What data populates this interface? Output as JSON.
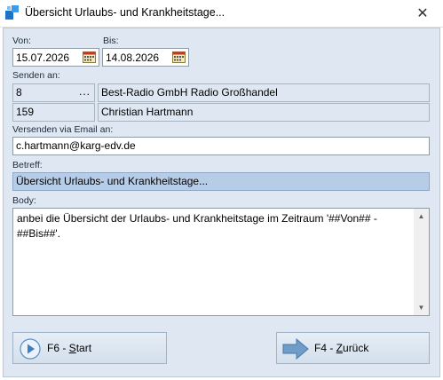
{
  "window": {
    "title": "Übersicht Urlaubs- und Krankheitstage...",
    "close_glyph": "✕"
  },
  "dates": {
    "von_label": "Von:",
    "von_value": "15.07.2026",
    "bis_label": "Bis:",
    "bis_value": "14.08.2026"
  },
  "recipients": {
    "label": "Senden an:",
    "row1": {
      "code": "8",
      "dots": "...",
      "name": "Best-Radio GmbH Radio Großhandel"
    },
    "row2": {
      "code": "159",
      "name": "Christian Hartmann"
    }
  },
  "email": {
    "label": "Versenden via Email an:",
    "value": "c.hartmann@karg-edv.de"
  },
  "subject": {
    "label": "Betreff:",
    "value": "Übersicht Urlaubs- und Krankheitstage..."
  },
  "body": {
    "label": "Body:",
    "value": "anbei die Übersicht der Urlaubs- und Krankheitstage im Zeitraum '##Von## -\n##Bis##'."
  },
  "buttons": {
    "start": {
      "key": "F6 - ",
      "mnemonic": "S",
      "rest": "tart"
    },
    "back": {
      "key": "F4 - ",
      "mnemonic": "Z",
      "rest": "urück"
    }
  }
}
